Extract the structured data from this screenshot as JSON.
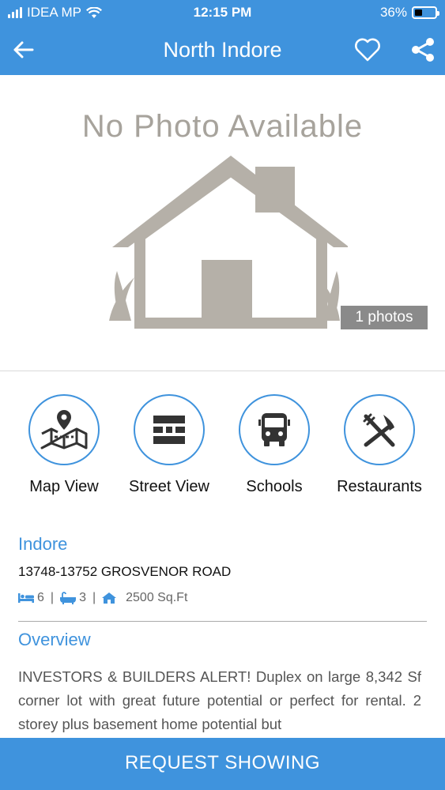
{
  "status_bar": {
    "carrier": "IDEA MP",
    "time": "12:15 PM",
    "battery": "36%",
    "battery_level": 0.36
  },
  "header": {
    "title": "North Indore",
    "back_icon": "arrow-left-icon",
    "favorite_icon": "heart-icon",
    "share_icon": "share-icon"
  },
  "photo": {
    "placeholder_text": "No Photo Available",
    "photo_count": "1 photos"
  },
  "features": [
    {
      "label": "Map View",
      "icon": "map-pin-icon"
    },
    {
      "label": "Street View",
      "icon": "road-icon"
    },
    {
      "label": "Schools",
      "icon": "bus-icon"
    },
    {
      "label": "Restaurants",
      "icon": "fork-knife-icon"
    }
  ],
  "listing": {
    "city": "Indore",
    "address": "13748-13752 GROSVENOR ROAD",
    "beds": "6",
    "baths": "3",
    "area": "2500 Sq.Ft"
  },
  "overview": {
    "title": "Overview",
    "text": "INVESTORS & BUILDERS ALERT! Duplex on large 8,342 Sf corner lot with great future potential or perfect for rental. 2 storey plus basement home potential but"
  },
  "cta": {
    "label": "REQUEST SHOWING"
  },
  "colors": {
    "accent": "#3f93dd",
    "placeholder_gray": "#a7a39c"
  }
}
